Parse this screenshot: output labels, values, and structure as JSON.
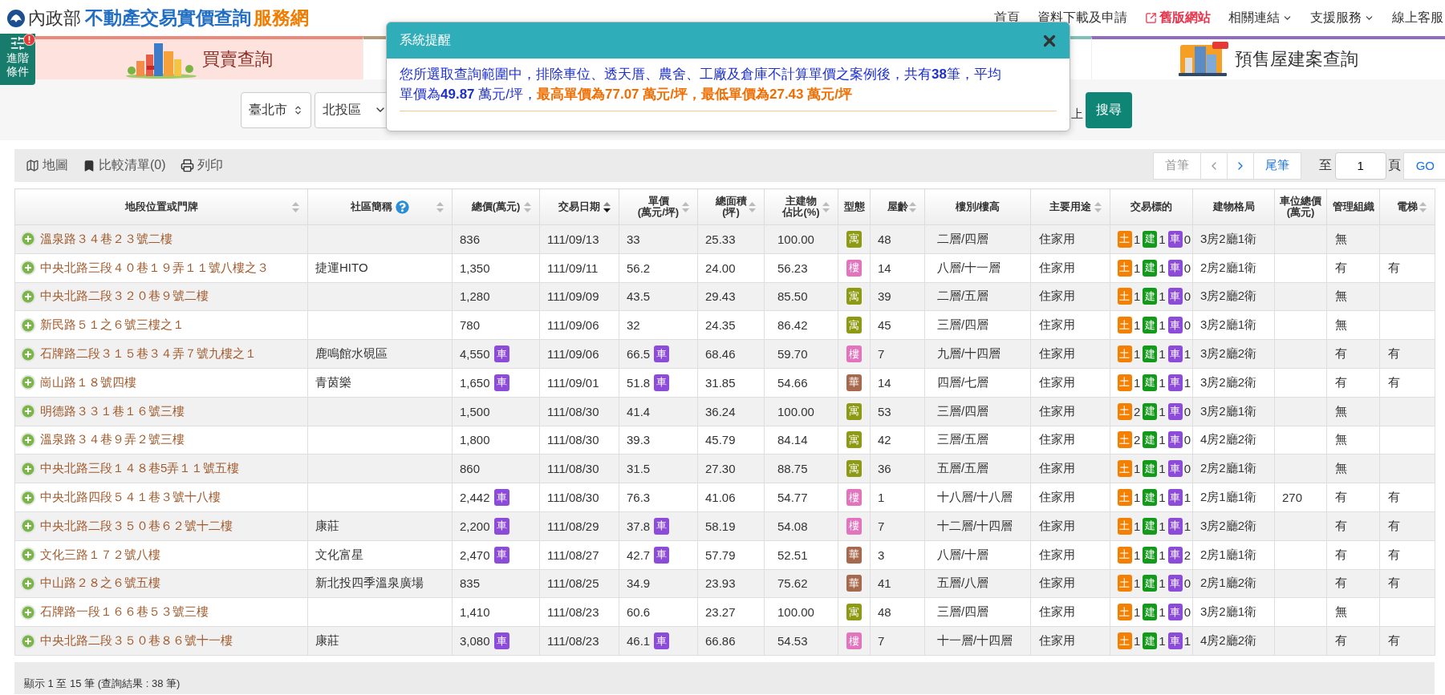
{
  "header": {
    "ministry": "內政部",
    "site_title": "不動產交易實價查詢",
    "site_suffix": "服務網",
    "nav": [
      {
        "label": "首頁",
        "kind": "plain"
      },
      {
        "label": "資料下載及申請",
        "kind": "plain"
      },
      {
        "label": "舊版網站",
        "kind": "external"
      },
      {
        "label": "相關連結",
        "kind": "dropdown"
      },
      {
        "label": "支援服務",
        "kind": "dropdown"
      },
      {
        "label": "線上客服",
        "kind": "plain"
      }
    ]
  },
  "advanced": {
    "label": "進階條件",
    "alert": true
  },
  "tabs": [
    {
      "label": "買賣查詢",
      "kind": "sale",
      "selected": true,
      "color": "#e8897c"
    },
    {
      "selected": false,
      "color": "#b59a78"
    },
    {
      "selected": false,
      "color": "#7fc1b8"
    },
    {
      "label": "預售屋建案查詢",
      "kind": "presale",
      "selected": false,
      "color": "#8f6cc0"
    }
  ],
  "search_bar": {
    "city": "臺北市",
    "district": "北投區",
    "trailing_text": "上",
    "button": "搜尋"
  },
  "dialog": {
    "title": "系統提醒",
    "lines": [
      [
        {
          "text": "您所選取查詢範圍中，排除車位、透天厝、農舍、工廠及倉庫不計算單價之案例後，共有**38**筆，平均",
          "highlight": false
        }
      ],
      [
        {
          "text": "單價為**49.87** 萬元/坪，",
          "highlight": false
        },
        {
          "text": "**最高單價為77.07 萬元/坪，最低單價為27.43 萬元/坪**",
          "highlight": true
        }
      ]
    ]
  },
  "toolbar": {
    "actions": [
      {
        "label": "地圖",
        "kind": "map"
      },
      {
        "label": "比較清單(0)",
        "kind": "compare"
      },
      {
        "label": "列印",
        "kind": "print"
      }
    ],
    "pager": {
      "first": {
        "label": "首筆",
        "disabled": true
      },
      "prev_disabled": true,
      "next_disabled": false,
      "last": {
        "label": "尾筆",
        "disabled": false
      },
      "goto_label": "至",
      "page": "1",
      "page_label": "頁",
      "go": "GO"
    }
  },
  "table": {
    "columns": [
      {
        "lines": [
          "地段位置或門牌"
        ],
        "sortable": true
      },
      {
        "lines": [
          "社區簡稱"
        ],
        "sortable": true,
        "help": true
      },
      {
        "lines": [
          "總價(萬元)"
        ],
        "sortable": true
      },
      {
        "lines": [
          "交易日期"
        ],
        "sortable": true,
        "sorted_descending": true
      },
      {
        "lines": [
          "單價",
          "(萬元/坪)"
        ],
        "sortable": true
      },
      {
        "lines": [
          "總面積",
          "(坪)"
        ],
        "sortable": true
      },
      {
        "lines": [
          "主建物",
          "佔比(%)"
        ],
        "sortable": true
      },
      {
        "lines": [
          "型態"
        ],
        "sortable": false
      },
      {
        "lines": [
          "屋齡"
        ],
        "sortable": true
      },
      {
        "lines": [
          "樓別/樓高"
        ],
        "sortable": false
      },
      {
        "lines": [
          "主要用途"
        ],
        "sortable": true
      },
      {
        "lines": [
          "交易標的"
        ],
        "sortable": false
      },
      {
        "lines": [
          "建物格局"
        ],
        "sortable": false
      },
      {
        "lines": [
          "車位總價",
          "(萬元)"
        ],
        "sortable": false
      },
      {
        "lines": [
          "管理組織"
        ],
        "sortable": false
      },
      {
        "lines": [
          "電梯"
        ],
        "sortable": true
      }
    ],
    "rows": [
      {
        "address": "溫泉路３４巷２３號二樓",
        "price": "836",
        "date": "111/09/13",
        "unit_price": "33",
        "area": "25.33",
        "main_ratio": "100.00",
        "type": {
          "label": "寓",
          "color": "#8e9a14"
        },
        "age": "48",
        "floor": "二層/四層",
        "usage": "住家用",
        "targets": [
          {
            "kind": "land",
            "label": "土",
            "count": "1"
          },
          {
            "kind": "building",
            "label": "建",
            "count": "1"
          },
          {
            "kind": "parking",
            "label": "車",
            "count": "0"
          }
        ],
        "layout": "3房2廳1衛",
        "management": "無"
      },
      {
        "address": "中央北路三段４０巷１９弄１１號八樓之３",
        "community": "捷運HITO",
        "price": "1,350",
        "date": "111/09/11",
        "unit_price": "56.2",
        "area": "24.00",
        "main_ratio": "56.23",
        "type": {
          "label": "樓",
          "color": "#e274bd"
        },
        "age": "14",
        "floor": "八層/十一層",
        "usage": "住家用",
        "targets": [
          {
            "kind": "land",
            "label": "土",
            "count": "1"
          },
          {
            "kind": "building",
            "label": "建",
            "count": "1"
          },
          {
            "kind": "parking",
            "label": "車",
            "count": "0"
          }
        ],
        "layout": "2房2廳1衛",
        "management": "有",
        "elevator": "有"
      },
      {
        "address": "中央北路二段３２０巷９號二樓",
        "price": "1,280",
        "date": "111/09/09",
        "unit_price": "43.5",
        "area": "29.43",
        "main_ratio": "85.50",
        "type": {
          "label": "寓",
          "color": "#8e9a14"
        },
        "age": "39",
        "floor": "二層/五層",
        "usage": "住家用",
        "targets": [
          {
            "kind": "land",
            "label": "土",
            "count": "1"
          },
          {
            "kind": "building",
            "label": "建",
            "count": "1"
          },
          {
            "kind": "parking",
            "label": "車",
            "count": "0"
          }
        ],
        "layout": "3房2廳2衛",
        "management": "無"
      },
      {
        "address": "新民路５１之６號三樓之１",
        "price": "780",
        "date": "111/09/06",
        "unit_price": "32",
        "area": "24.35",
        "main_ratio": "86.42",
        "type": {
          "label": "寓",
          "color": "#8e9a14"
        },
        "age": "45",
        "floor": "三層/四層",
        "usage": "住家用",
        "targets": [
          {
            "kind": "land",
            "label": "土",
            "count": "1"
          },
          {
            "kind": "building",
            "label": "建",
            "count": "1"
          },
          {
            "kind": "parking",
            "label": "車",
            "count": "0"
          }
        ],
        "layout": "3房2廳1衛",
        "management": "無"
      },
      {
        "address": "石牌路二段３１５巷３４弄７號九樓之１",
        "community": "鹿鳴館水硯區",
        "price": "4,550",
        "price_tag": "車",
        "date": "111/09/06",
        "unit_price": "66.5",
        "unit_price_tag": "車",
        "area": "68.46",
        "main_ratio": "59.70",
        "type": {
          "label": "樓",
          "color": "#e274bd"
        },
        "age": "7",
        "floor": "九層/十四層",
        "usage": "住家用",
        "targets": [
          {
            "kind": "land",
            "label": "土",
            "count": "1"
          },
          {
            "kind": "building",
            "label": "建",
            "count": "1"
          },
          {
            "kind": "parking",
            "label": "車",
            "count": "1"
          }
        ],
        "layout": "3房2廳2衛",
        "management": "有",
        "elevator": "有"
      },
      {
        "address": "崗山路１８號四樓",
        "community": "青茵樂",
        "price": "1,650",
        "price_tag": "車",
        "date": "111/09/01",
        "unit_price": "51.8",
        "unit_price_tag": "車",
        "area": "31.85",
        "main_ratio": "54.66",
        "type": {
          "label": "華",
          "color": "#a7694e"
        },
        "age": "14",
        "floor": "四層/七層",
        "usage": "住家用",
        "targets": [
          {
            "kind": "land",
            "label": "土",
            "count": "1"
          },
          {
            "kind": "building",
            "label": "建",
            "count": "1"
          },
          {
            "kind": "parking",
            "label": "車",
            "count": "1"
          }
        ],
        "layout": "3房2廳2衛",
        "management": "有",
        "elevator": "有"
      },
      {
        "address": "明德路３３１巷１６號三樓",
        "price": "1,500",
        "date": "111/08/30",
        "unit_price": "41.4",
        "area": "36.24",
        "main_ratio": "100.00",
        "type": {
          "label": "寓",
          "color": "#8e9a14"
        },
        "age": "53",
        "floor": "三層/四層",
        "usage": "住家用",
        "targets": [
          {
            "kind": "land",
            "label": "土",
            "count": "2"
          },
          {
            "kind": "building",
            "label": "建",
            "count": "1"
          },
          {
            "kind": "parking",
            "label": "車",
            "count": "0"
          }
        ],
        "layout": "3房2廳1衛",
        "management": "無"
      },
      {
        "address": "溫泉路３４巷９弄２號三樓",
        "price": "1,800",
        "date": "111/08/30",
        "unit_price": "39.3",
        "area": "45.79",
        "main_ratio": "84.14",
        "type": {
          "label": "寓",
          "color": "#8e9a14"
        },
        "age": "42",
        "floor": "三層/五層",
        "usage": "住家用",
        "targets": [
          {
            "kind": "land",
            "label": "土",
            "count": "2"
          },
          {
            "kind": "building",
            "label": "建",
            "count": "1"
          },
          {
            "kind": "parking",
            "label": "車",
            "count": "0"
          }
        ],
        "layout": "4房2廳2衛",
        "management": "無"
      },
      {
        "address": "中央北路三段１４８巷5弄１１號五樓",
        "price": "860",
        "date": "111/08/30",
        "unit_price": "31.5",
        "area": "27.30",
        "main_ratio": "88.75",
        "type": {
          "label": "寓",
          "color": "#8e9a14"
        },
        "age": "36",
        "floor": "五層/五層",
        "usage": "住家用",
        "targets": [
          {
            "kind": "land",
            "label": "土",
            "count": "1"
          },
          {
            "kind": "building",
            "label": "建",
            "count": "1"
          },
          {
            "kind": "parking",
            "label": "車",
            "count": "0"
          }
        ],
        "layout": "2房2廳1衛",
        "management": "無"
      },
      {
        "address": "中央北路四段５４１巷３號十八樓",
        "price": "2,442",
        "price_tag": "車",
        "date": "111/08/30",
        "unit_price": "76.3",
        "area": "41.06",
        "main_ratio": "54.77",
        "type": {
          "label": "樓",
          "color": "#e274bd"
        },
        "age": "1",
        "floor": "十八層/十八層",
        "usage": "住家用",
        "targets": [
          {
            "kind": "land",
            "label": "土",
            "count": "1"
          },
          {
            "kind": "building",
            "label": "建",
            "count": "1"
          },
          {
            "kind": "parking",
            "label": "車",
            "count": "1"
          }
        ],
        "layout": "2房1廳1衛",
        "parking_price": "270",
        "management": "有",
        "elevator": "有"
      },
      {
        "address": "中央北路二段３５０巷６２號十二樓",
        "community": "康莊",
        "price": "2,200",
        "price_tag": "車",
        "date": "111/08/29",
        "unit_price": "37.8",
        "unit_price_tag": "車",
        "area": "58.19",
        "main_ratio": "54.08",
        "type": {
          "label": "樓",
          "color": "#e274bd"
        },
        "age": "7",
        "floor": "十二層/十四層",
        "usage": "住家用",
        "targets": [
          {
            "kind": "land",
            "label": "土",
            "count": "1"
          },
          {
            "kind": "building",
            "label": "建",
            "count": "1"
          },
          {
            "kind": "parking",
            "label": "車",
            "count": "1"
          }
        ],
        "layout": "3房2廳2衛",
        "management": "有",
        "elevator": "有"
      },
      {
        "address": "文化三路１７２號八樓",
        "community": "文化富星",
        "price": "2,470",
        "price_tag": "車",
        "date": "111/08/27",
        "unit_price": "42.7",
        "unit_price_tag": "車",
        "area": "57.79",
        "main_ratio": "52.51",
        "type": {
          "label": "華",
          "color": "#a7694e"
        },
        "age": "3",
        "floor": "八層/十層",
        "usage": "住家用",
        "targets": [
          {
            "kind": "land",
            "label": "土",
            "count": "1"
          },
          {
            "kind": "building",
            "label": "建",
            "count": "1"
          },
          {
            "kind": "parking",
            "label": "車",
            "count": "2"
          }
        ],
        "layout": "2房1廳1衛",
        "management": "有",
        "elevator": "有"
      },
      {
        "address": "中山路２８之６號五樓",
        "community": "新北投四季溫泉廣場",
        "price": "835",
        "date": "111/08/25",
        "unit_price": "34.9",
        "area": "23.93",
        "main_ratio": "75.62",
        "type": {
          "label": "華",
          "color": "#a7694e"
        },
        "age": "41",
        "floor": "五層/八層",
        "usage": "住家用",
        "targets": [
          {
            "kind": "land",
            "label": "土",
            "count": "1"
          },
          {
            "kind": "building",
            "label": "建",
            "count": "1"
          },
          {
            "kind": "parking",
            "label": "車",
            "count": "0"
          }
        ],
        "layout": "2房1廳2衛",
        "management": "有",
        "elevator": "有"
      },
      {
        "address": "石牌路一段１６６巷５３號三樓",
        "price": "1,410",
        "date": "111/08/23",
        "unit_price": "60.6",
        "area": "23.27",
        "main_ratio": "100.00",
        "type": {
          "label": "寓",
          "color": "#8e9a14"
        },
        "age": "48",
        "floor": "三層/四層",
        "usage": "住家用",
        "targets": [
          {
            "kind": "land",
            "label": "土",
            "count": "1"
          },
          {
            "kind": "building",
            "label": "建",
            "count": "1"
          },
          {
            "kind": "parking",
            "label": "車",
            "count": "0"
          }
        ],
        "layout": "3房2廳1衛",
        "management": "無"
      },
      {
        "address": "中央北路二段３５０巷８６號十一樓",
        "community": "康莊",
        "price": "3,080",
        "price_tag": "車",
        "date": "111/08/23",
        "unit_price": "46.1",
        "unit_price_tag": "車",
        "area": "66.86",
        "main_ratio": "54.53",
        "type": {
          "label": "樓",
          "color": "#e274bd"
        },
        "age": "7",
        "floor": "十一層/十四層",
        "usage": "住家用",
        "targets": [
          {
            "kind": "land",
            "label": "土",
            "count": "1"
          },
          {
            "kind": "building",
            "label": "建",
            "count": "1"
          },
          {
            "kind": "parking",
            "label": "車",
            "count": "1"
          }
        ],
        "layout": "4房2廳2衛",
        "management": "有",
        "elevator": "有"
      }
    ]
  },
  "footer": "顯示 1 至 15 筆 (查詢結果 : 38 筆)"
}
